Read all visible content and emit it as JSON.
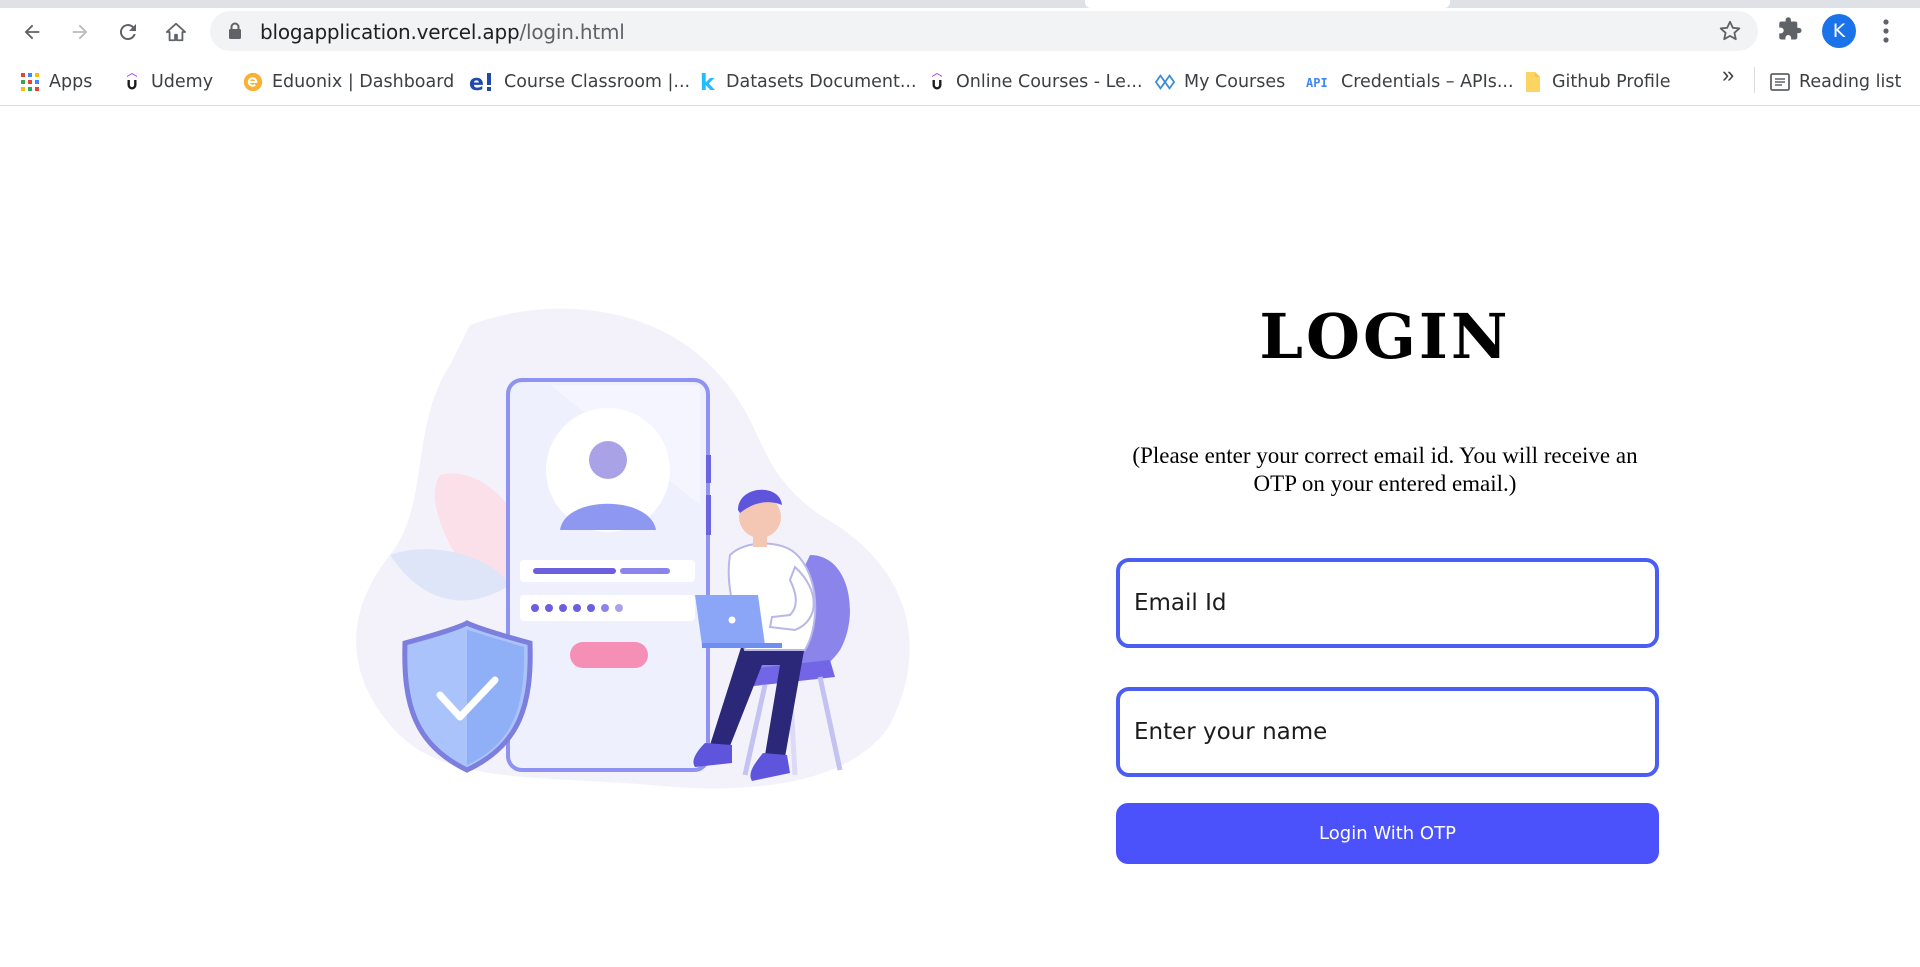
{
  "browser": {
    "url_host": "blogapplication.vercel.app",
    "url_path": "/login.html",
    "profile_initial": "K",
    "bookmarks": [
      {
        "label": "Apps",
        "icon": "apps-grid-icon"
      },
      {
        "label": "Udemy",
        "icon": "udemy-icon"
      },
      {
        "label": "Eduonix | Dashboard",
        "icon": "eduonix-icon"
      },
      {
        "label": "Course Classroom |...",
        "icon": "course-classroom-icon"
      },
      {
        "label": "Datasets Document...",
        "icon": "kaggle-icon"
      },
      {
        "label": "Online Courses - Le...",
        "icon": "udemy-icon"
      },
      {
        "label": "My Courses",
        "icon": "my-courses-icon"
      },
      {
        "label": "Credentials – APIs...",
        "icon": "api-icon"
      },
      {
        "label": "Github Profile",
        "icon": "folder-icon"
      }
    ],
    "overflow_label": "»",
    "reading_list_label": "Reading list"
  },
  "page": {
    "title": "LOGIN",
    "instructions": "(Please enter your correct email id. You will receive an OTP on your entered email.)",
    "email_placeholder": "Email Id",
    "name_placeholder": "Enter your name",
    "submit_label": "Login With OTP"
  },
  "colors": {
    "accent": "#4a5ef2",
    "button": "#4c52fb",
    "illustration_purple": "#6b63e0"
  }
}
